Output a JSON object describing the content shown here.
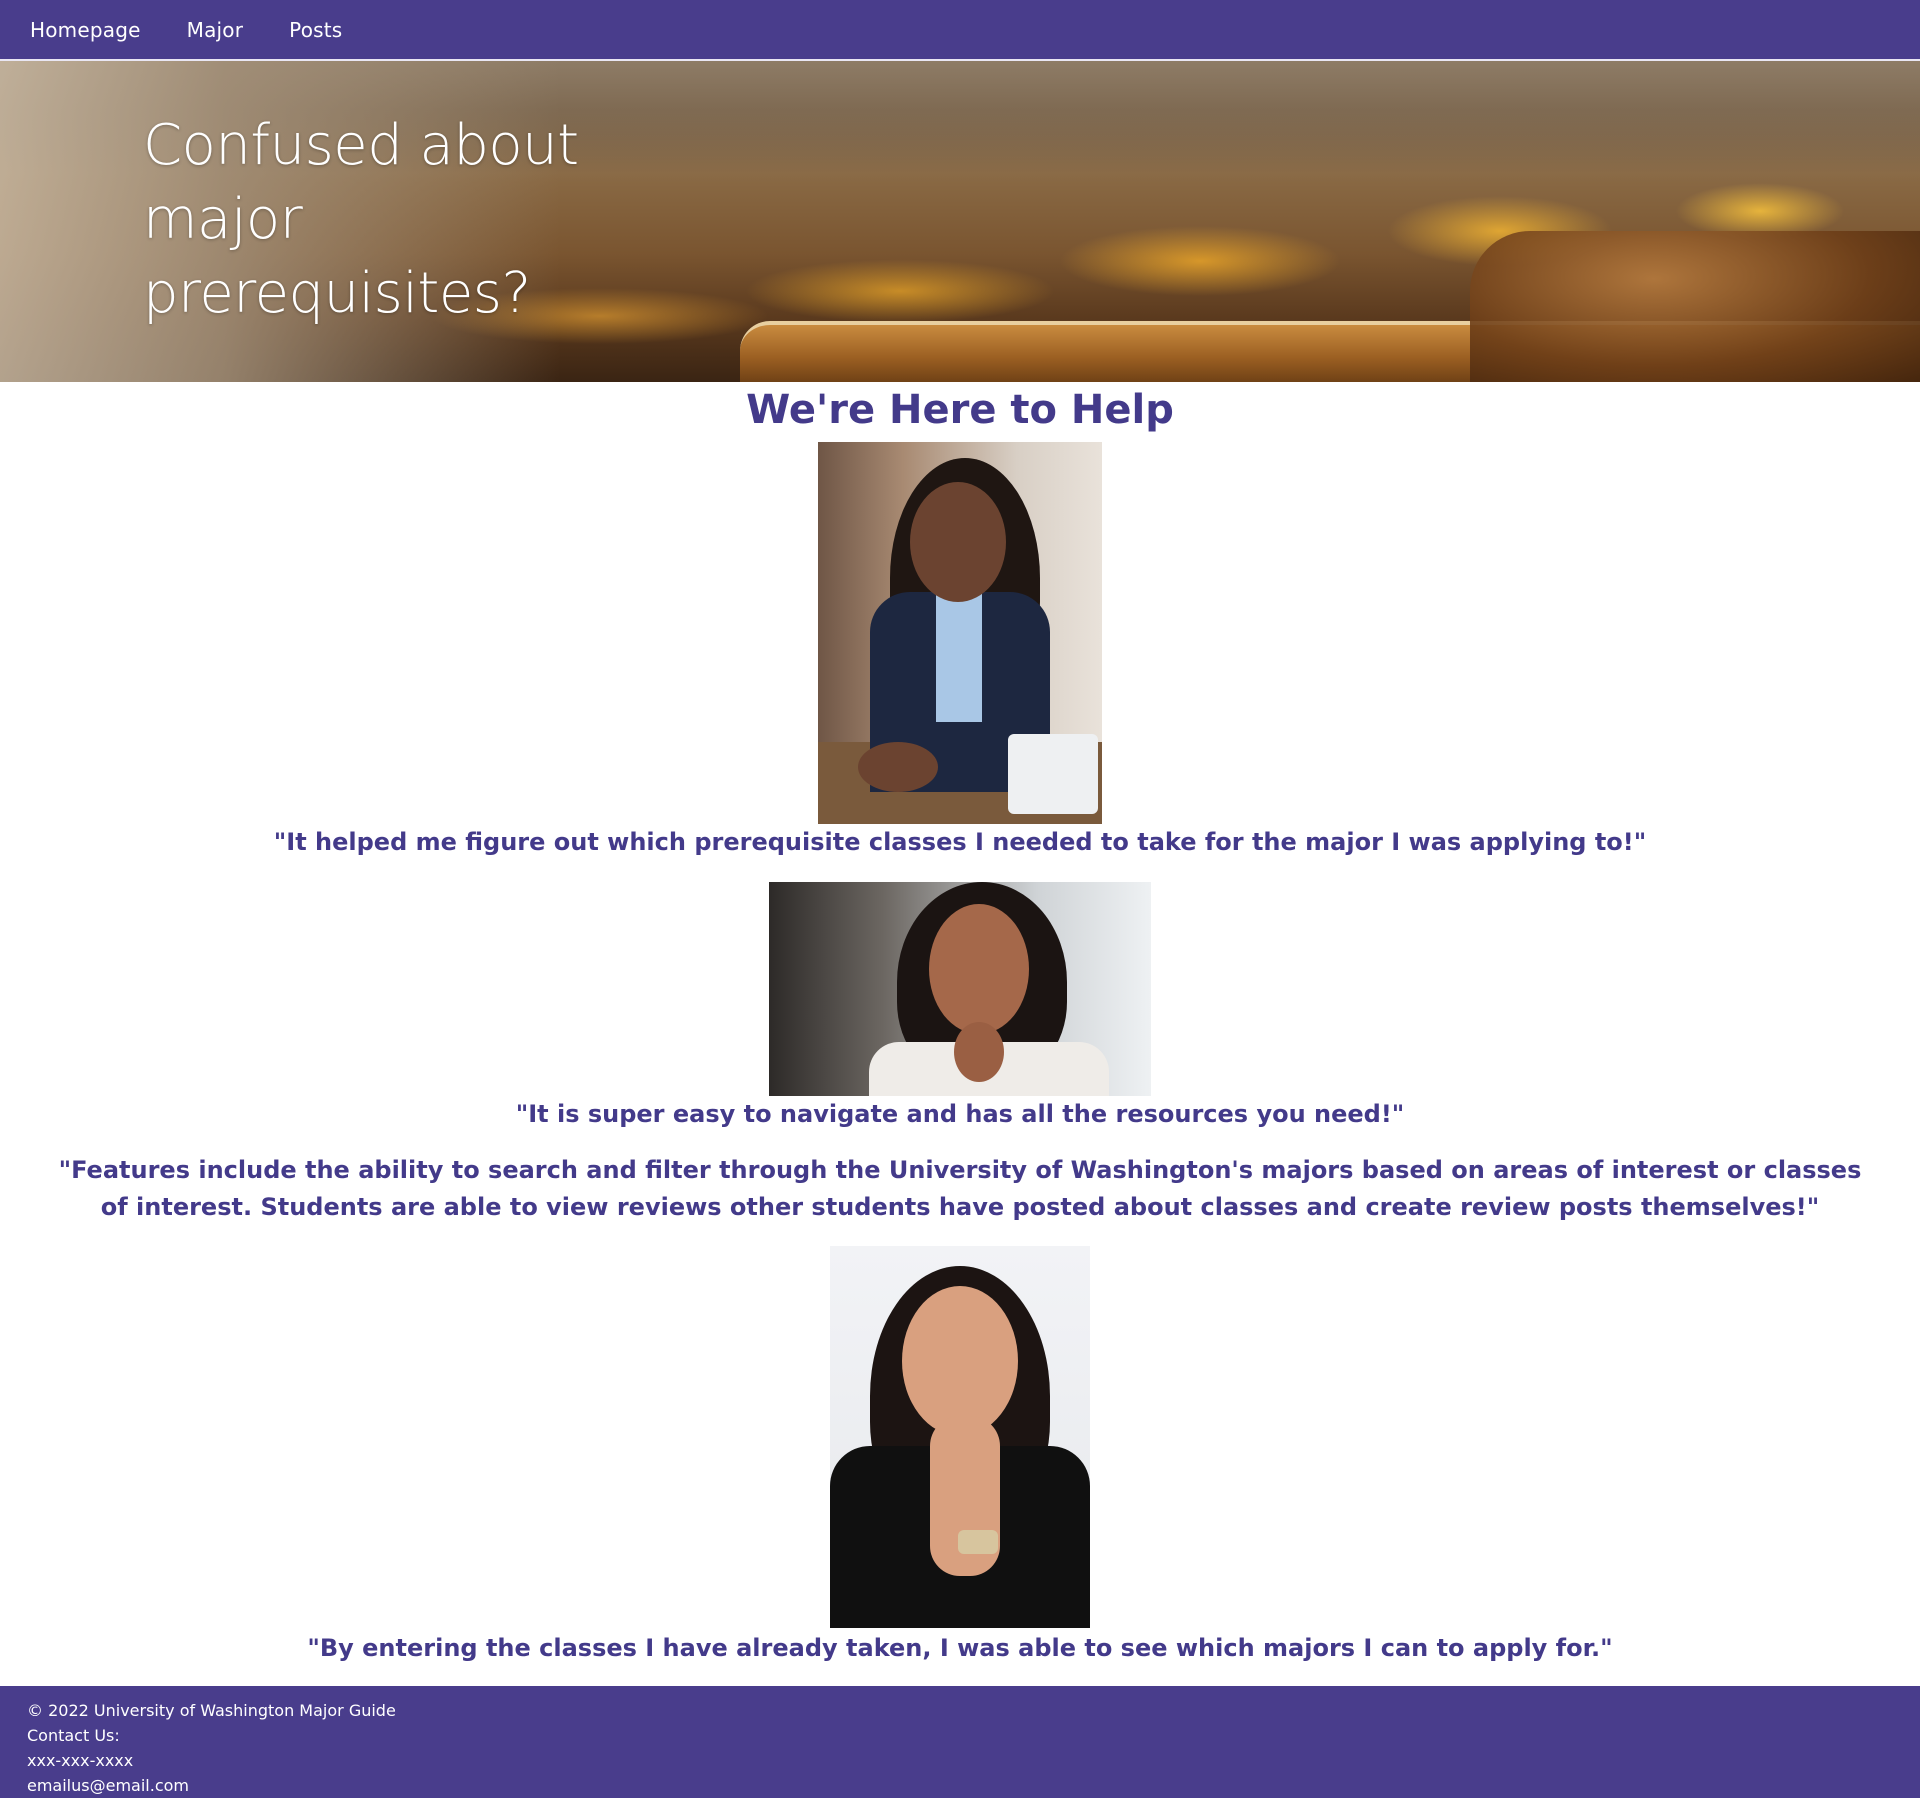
{
  "nav": {
    "items": [
      {
        "label": "Homepage"
      },
      {
        "label": "Major"
      },
      {
        "label": "Posts"
      }
    ]
  },
  "hero": {
    "title_lines": [
      "Confused about",
      "major",
      "prerequisites?"
    ]
  },
  "main": {
    "heading": "We're Here to Help",
    "testimonials": [
      {
        "quote": "\"It helped me figure out which prerequisite classes I needed to take for the major I was applying to!\""
      },
      {
        "quote": "\"It is super easy to navigate and has all the resources you need!\""
      },
      {
        "quote": "\"Features include the ability to search and filter through the University of Washington's majors based on areas of interest or classes of interest. Students are able to view reviews other students have posted about classes and create review posts themselves!\""
      },
      {
        "quote": "\"By entering the classes I have already taken, I was able to see which majors I can to apply for.\""
      }
    ]
  },
  "footer": {
    "copyright": "© 2022 University of Washington Major Guide",
    "contact_label": "Contact Us:",
    "phone": "xxx-xxx-xxxx",
    "email": "emailus@email.com"
  },
  "colors": {
    "brand_purple": "#493d8c",
    "heading_purple": "#433a8a",
    "text_white": "#ffffff"
  }
}
